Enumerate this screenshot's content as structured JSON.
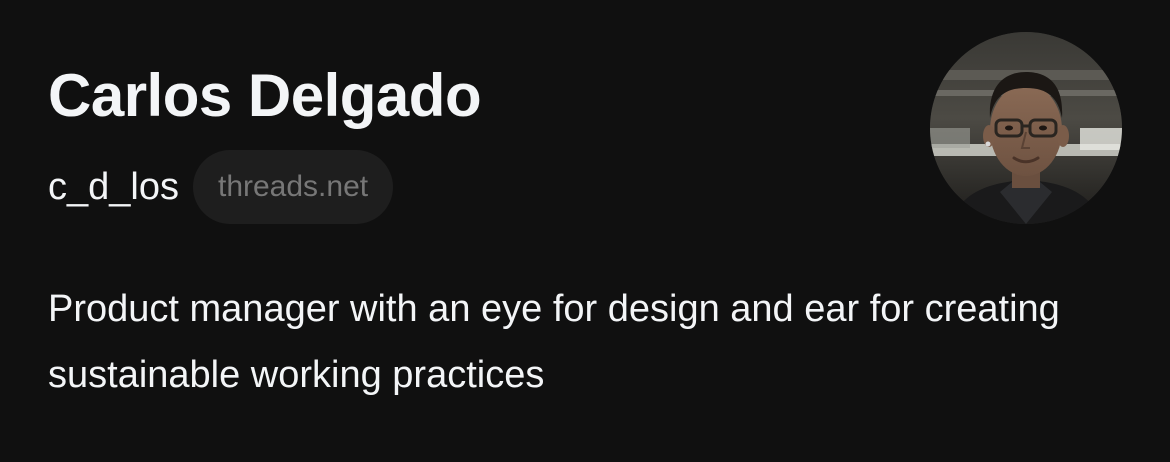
{
  "profile": {
    "display_name": "Carlos Delgado",
    "username": "c_d_los",
    "domain_badge": "threads.net",
    "bio": "Product manager with an eye for design and ear for creating sustainable working practices",
    "avatar_icon": "profile-photo-avatar"
  },
  "colors": {
    "background": "#101010",
    "primary_text": "#f3f5f7",
    "secondary_text": "#777777",
    "pill_background": "#1e1e1e"
  }
}
